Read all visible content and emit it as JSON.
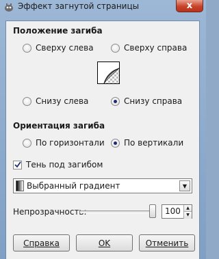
{
  "window": {
    "title": "Эффект загнутой страницы",
    "close_label": "x"
  },
  "curl_location": {
    "heading": "Положение загиба",
    "options": [
      {
        "label": "Сверху слева",
        "selected": false
      },
      {
        "label": "Сверху справа",
        "selected": false
      },
      {
        "label": "Снизу слева",
        "selected": false
      },
      {
        "label": "Снизу справа",
        "selected": true
      }
    ]
  },
  "curl_orientation": {
    "heading": "Ориентация загиба",
    "options": [
      {
        "label": "По горизонтали",
        "selected": false
      },
      {
        "label": "По вертикали",
        "selected": true
      }
    ]
  },
  "shade": {
    "label": "Тень под загибом",
    "checked": true
  },
  "gradient": {
    "value": "Выбранный градиент",
    "arrow": "▼"
  },
  "opacity": {
    "label": "Непрозрачность:",
    "value": "100",
    "level": 100
  },
  "buttons": {
    "help": "Справка",
    "ok": "OK",
    "cancel": "Отменить"
  },
  "icons": {
    "up": "▲",
    "down": "▼"
  },
  "colors": {
    "titlebar": "#9db8d6",
    "close": "#c7442a",
    "dialog_bg": "#f0f0f0"
  }
}
